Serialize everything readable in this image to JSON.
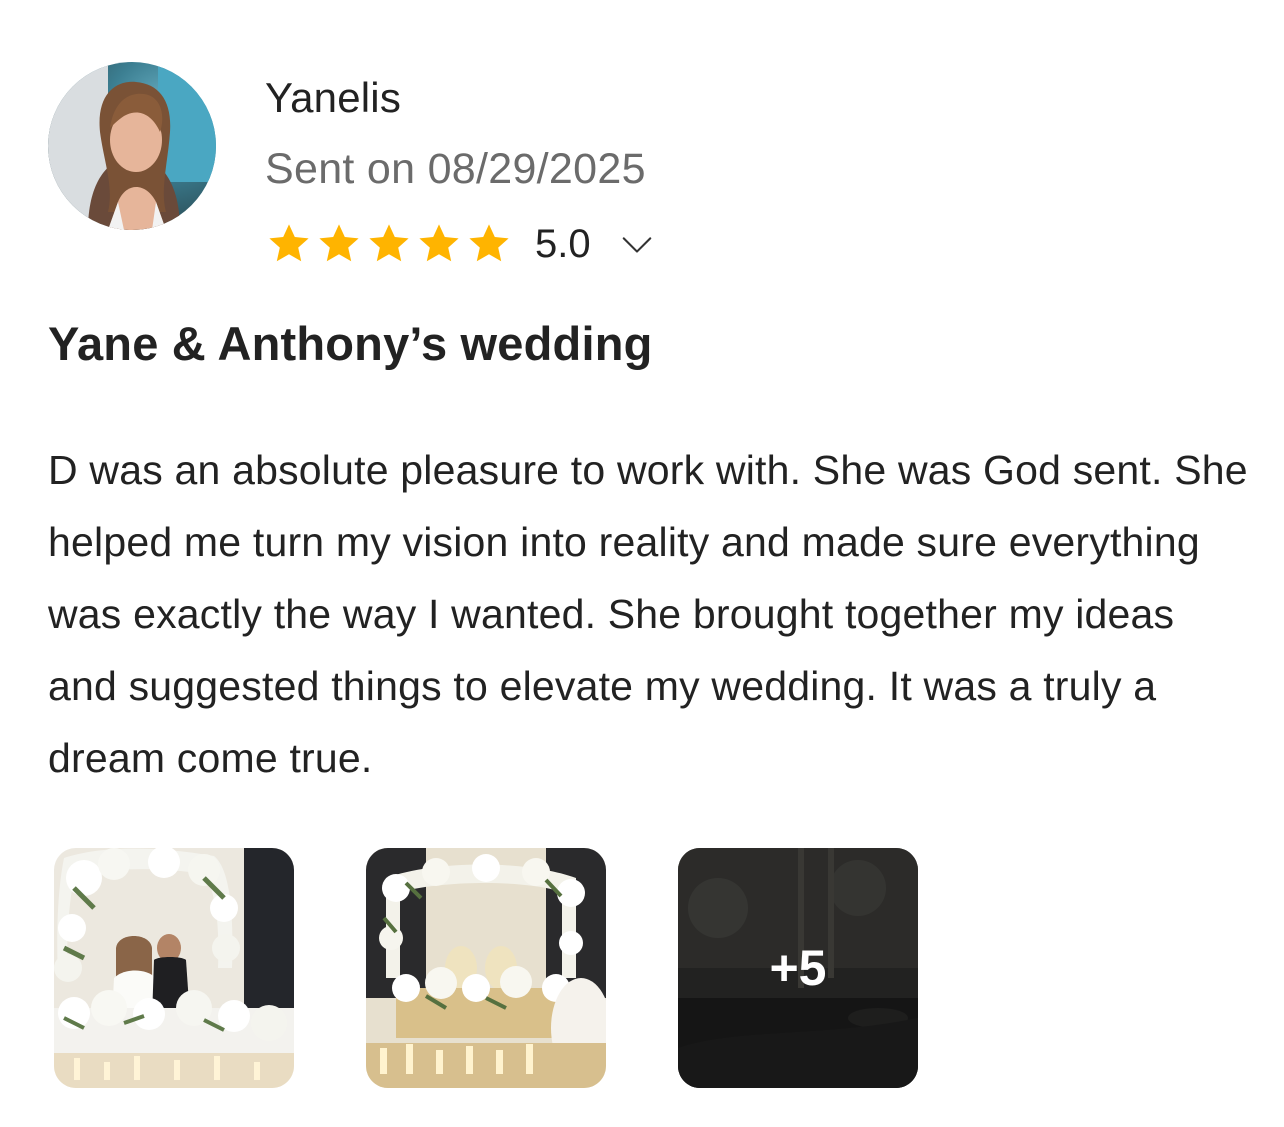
{
  "review": {
    "author": {
      "name": "Yanelis",
      "sent_on": "Sent on 08/29/2025",
      "avatar_icon": "user-avatar-photo"
    },
    "rating": {
      "stars": 5,
      "max_stars": 5,
      "value": "5.0",
      "star_color": "#FFB400"
    },
    "title": "Yane & Anthony’s wedding",
    "body": "D was an absolute pleasure to work with. She was God sent. She helped me turn my vision into reality and made sure everything was exactly the way I wanted. She brought together my ideas and suggested things to elevate my wedding. It was a truly a dream come true.",
    "photos": {
      "more_label": "+5"
    }
  }
}
